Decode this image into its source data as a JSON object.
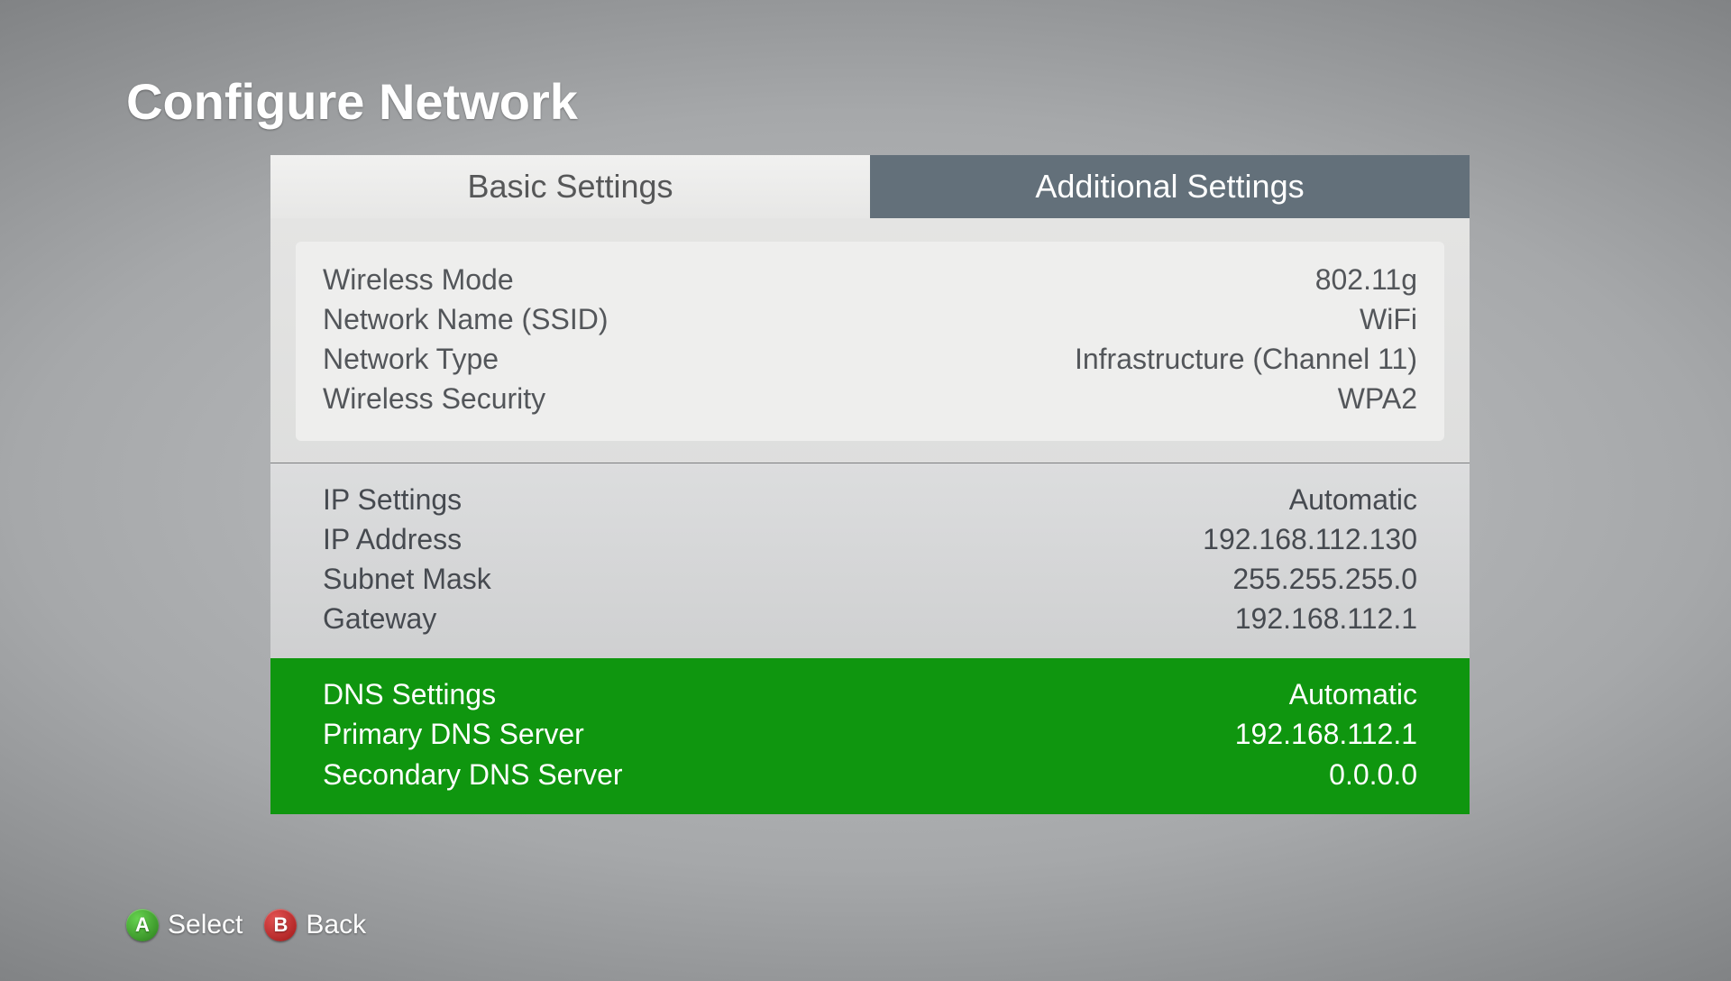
{
  "title": "Configure Network",
  "tabs": {
    "basic": "Basic Settings",
    "additional": "Additional Settings"
  },
  "wireless": {
    "mode_label": "Wireless Mode",
    "mode_value": "802.11g",
    "ssid_label": "Network Name (SSID)",
    "ssid_value": "WiFi",
    "type_label": "Network Type",
    "type_value": "Infrastructure (Channel 11)",
    "security_label": "Wireless Security",
    "security_value": "WPA2"
  },
  "ip": {
    "settings_label": "IP Settings",
    "settings_value": "Automatic",
    "address_label": "IP Address",
    "address_value": "192.168.112.130",
    "subnet_label": "Subnet Mask",
    "subnet_value": "255.255.255.0",
    "gateway_label": "Gateway",
    "gateway_value": "192.168.112.1"
  },
  "dns": {
    "settings_label": "DNS Settings",
    "settings_value": "Automatic",
    "primary_label": "Primary DNS Server",
    "primary_value": "192.168.112.1",
    "secondary_label": "Secondary DNS Server",
    "secondary_value": "0.0.0.0"
  },
  "hints": {
    "a_glyph": "A",
    "a_label": "Select",
    "b_glyph": "B",
    "b_label": "Back"
  }
}
